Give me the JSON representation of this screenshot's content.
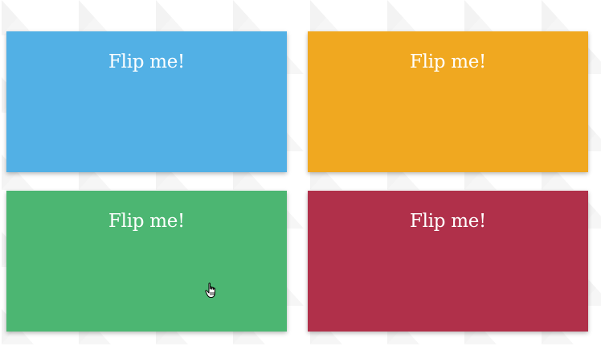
{
  "cards": [
    {
      "label": "Flip me!",
      "color": "#52B0E5"
    },
    {
      "label": "Flip me!",
      "color": "#F0A820"
    },
    {
      "label": "Flip me!",
      "color": "#4CB672"
    },
    {
      "label": "Flip me!",
      "color": "#B0304A"
    }
  ],
  "cursor": {
    "icon": "hand-pointer-icon"
  }
}
